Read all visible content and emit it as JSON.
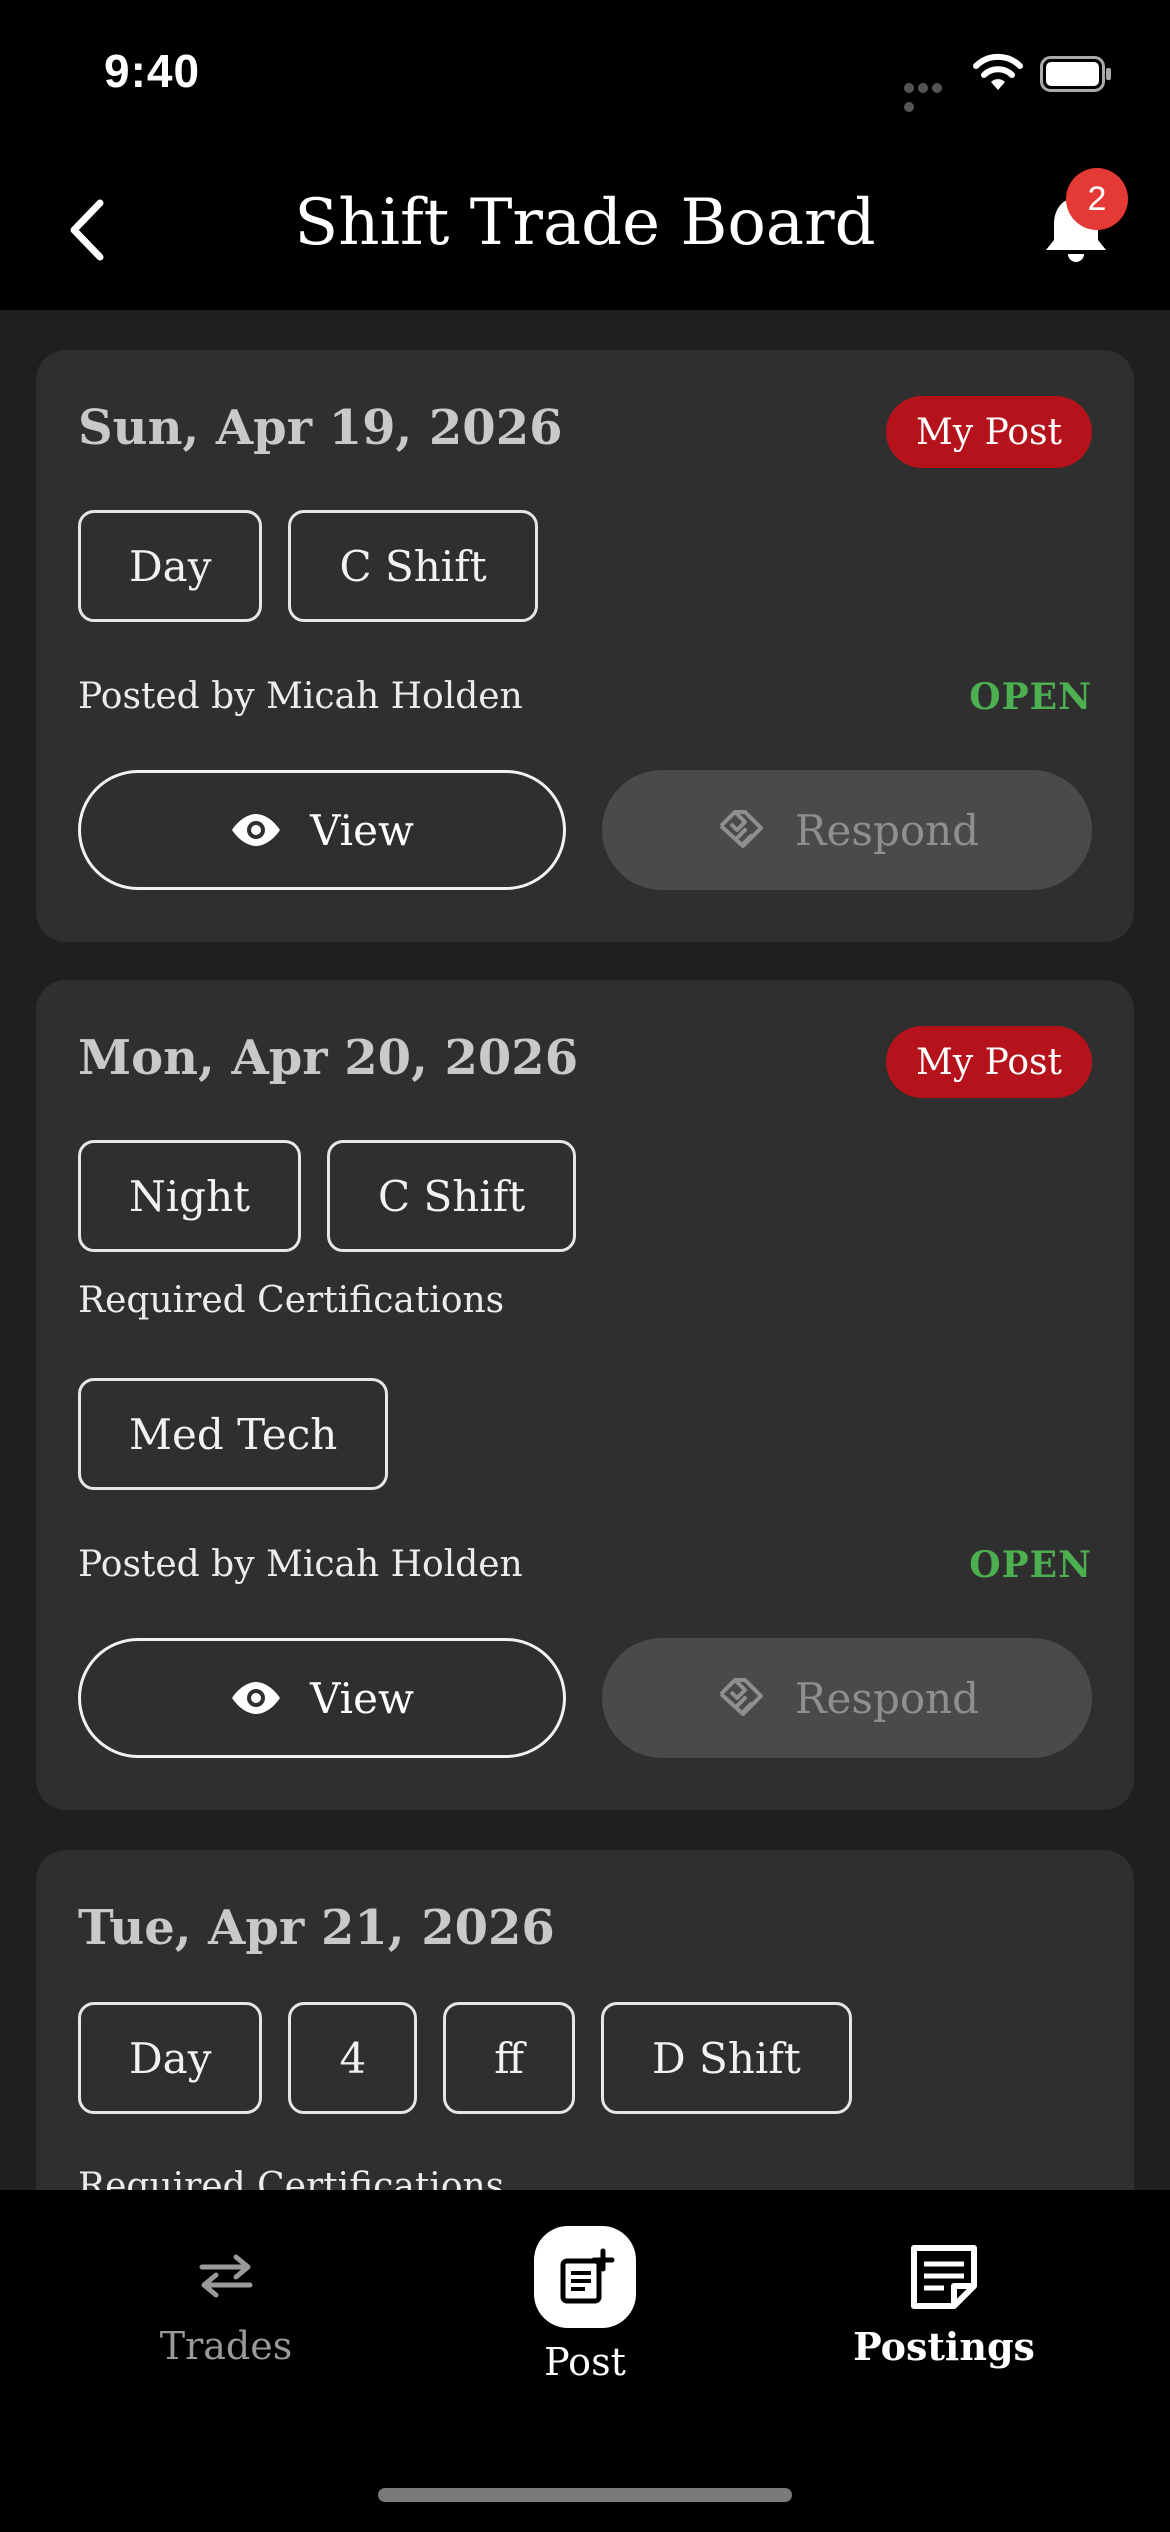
{
  "status_bar": {
    "time": "9:40"
  },
  "header": {
    "title": "Shift Trade Board",
    "notification_count": "2"
  },
  "cards": [
    {
      "date": "Sun, Apr 19, 2026",
      "badge": "My Post",
      "chips": [
        "Day",
        "C Shift"
      ],
      "posted_by": "Posted by Micah Holden",
      "status": "OPEN",
      "view_label": "View",
      "respond_label": "Respond"
    },
    {
      "date": "Mon, Apr 20, 2026",
      "badge": "My Post",
      "chips": [
        "Night",
        "C Shift"
      ],
      "certs_label": "Required Certifications",
      "certs": [
        "Med Tech"
      ],
      "posted_by": "Posted by Micah Holden",
      "status": "OPEN",
      "view_label": "View",
      "respond_label": "Respond"
    },
    {
      "date": "Tue, Apr 21, 2026",
      "chips": [
        "Day",
        "4",
        "ff",
        "D Shift"
      ],
      "certs_label": "Required Certifications"
    }
  ],
  "bottom_nav": {
    "trades": "Trades",
    "post": "Post",
    "postings": "Postings"
  },
  "colors": {
    "accent_red": "#b5121b",
    "open_green": "#4caf50",
    "badge_red": "#e53935"
  }
}
